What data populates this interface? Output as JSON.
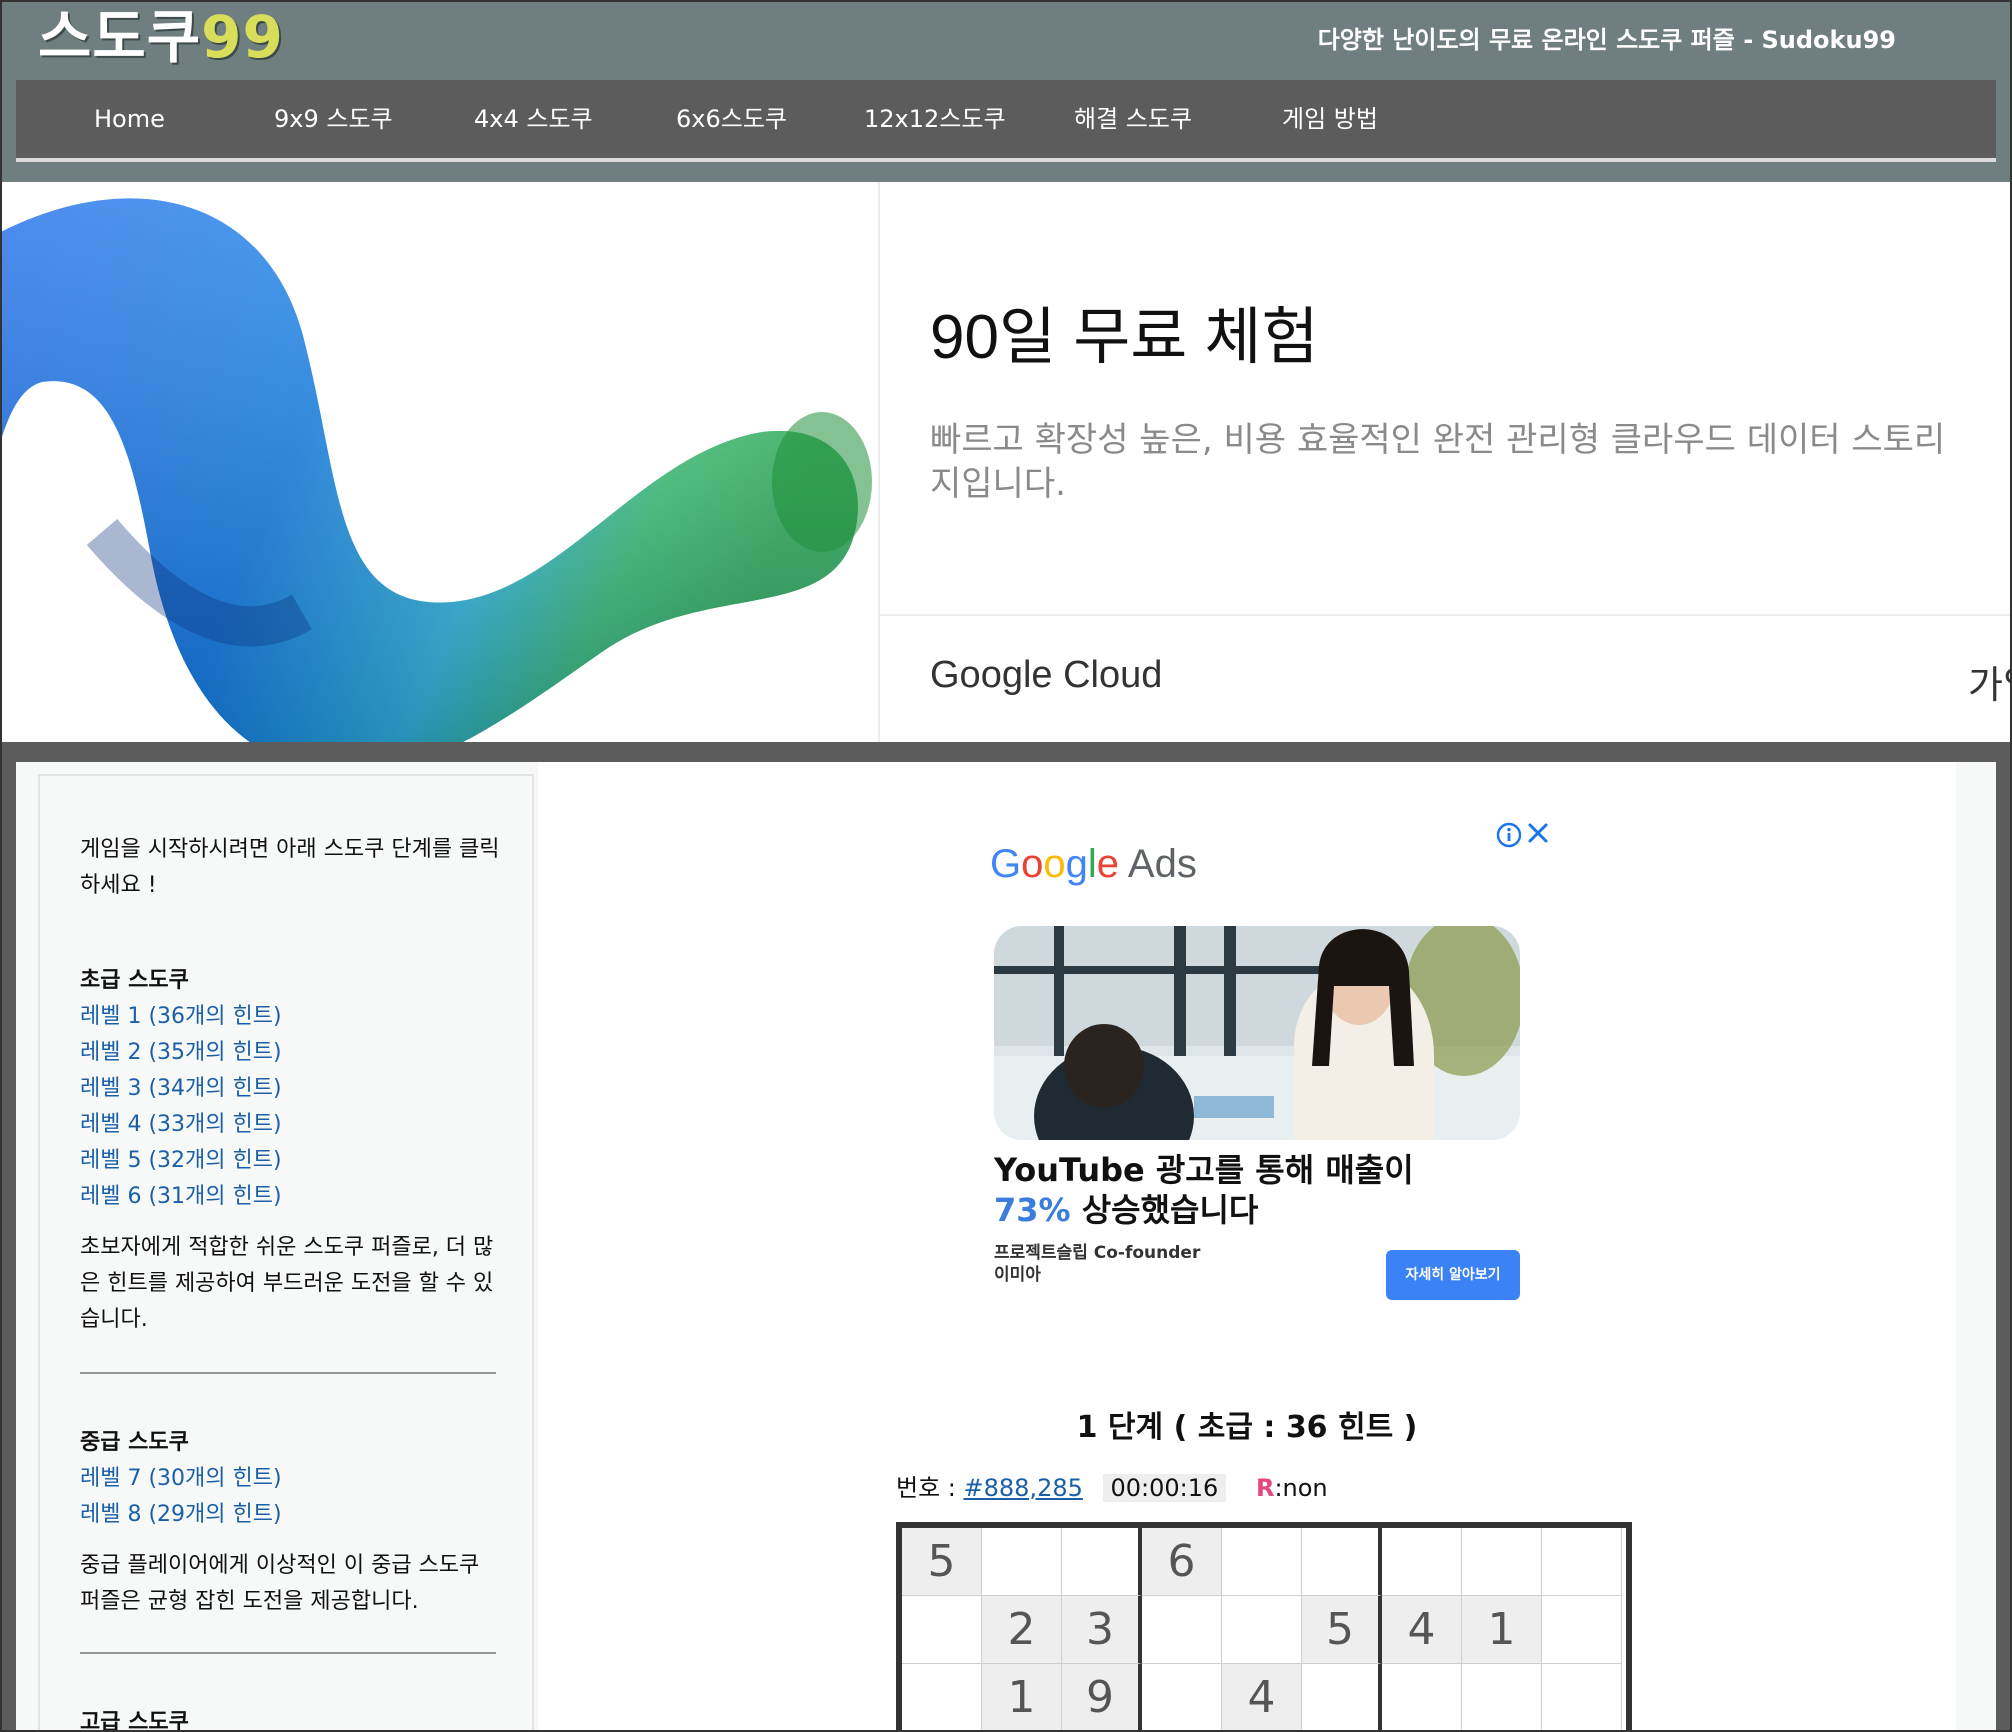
{
  "header": {
    "logo_text": "스도쿠",
    "logo_number": "99",
    "tagline": "다양한 난이도의 무료 온라인 스도쿠 퍼즐 - Sudoku99",
    "nav": [
      "Home",
      "9x9 스도쿠",
      "4x4 스도쿠",
      "6x6스도쿠",
      "12x12스도쿠",
      "해결 스도쿠",
      "게임 방법"
    ]
  },
  "banner_ad": {
    "title": "90일 무료 체험",
    "description": "빠르고 확장성 높은, 비용 효율적인 완전 관리형 클라우드 데이터 스토리지입니다.",
    "brand": "Google Cloud",
    "cta": "가입"
  },
  "sidebar": {
    "intro": "게임을 시작하시려면 아래 스도쿠 단계를 클릭하세요 !",
    "beginner": {
      "title": "초급 스도쿠",
      "levels": [
        "레벨 1 (36개의 힌트)",
        "레벨 2 (35개의 힌트)",
        "레벨 3 (34개의 힌트)",
        "레벨 4 (33개의 힌트)",
        "레벨 5 (32개의 힌트)",
        "레벨 6 (31개의 힌트)"
      ],
      "description": "초보자에게 적합한 쉬운 스도쿠 퍼즐로, 더 많은 힌트를 제공하여 부드러운 도전을 할 수 있습니다."
    },
    "intermediate": {
      "title": "중급 스도쿠",
      "levels": [
        "레벨 7 (30개의 힌트)",
        "레벨 8 (29개의 힌트)"
      ],
      "description": "중급 플레이어에게 이상적인 이 중급 스도쿠 퍼즐은 균형 잡힌 도전을 제공합니다."
    },
    "advanced": {
      "title": "고급 스도쿠"
    }
  },
  "ad": {
    "info_icon": "info-icon",
    "close_icon": "close-icon",
    "logo_google": [
      "G",
      "o",
      "o",
      "g",
      "l",
      "e"
    ],
    "logo_colors": [
      "#4285F4",
      "#EA4335",
      "#FBBC05",
      "#4285F4",
      "#34A853",
      "#EA4335"
    ],
    "logo_ads": "Ads",
    "headline_1": "YouTube 광고를 통해 매출이",
    "headline_pct": "73%",
    "headline_2": "상승했습니다",
    "credit_1": "프로젝트슬립 Co-founder",
    "credit_2": "이미아",
    "button": "자세히 알아보기"
  },
  "puzzle": {
    "title": "1 단계 ( 초급 : 36 힌트 )",
    "number_label": "번호 :",
    "number": "#888,285",
    "timer": "00:00:16",
    "r_label": "R",
    "r_value": ":non",
    "rows": [
      [
        "5",
        "",
        "",
        "6",
        "",
        "",
        "",
        "",
        ""
      ],
      [
        "",
        "2",
        "3",
        "",
        "",
        "5",
        "4",
        "1",
        ""
      ],
      [
        "",
        "1",
        "9",
        "",
        "4",
        "",
        "",
        "",
        ""
      ]
    ]
  },
  "colors": {
    "header_bg": "#6f7f7f",
    "nav_bg": "#5c5c5c",
    "logo_number": "#d9de5a",
    "link": "#1a5fa8",
    "ad_blue": "#3b82f6"
  }
}
